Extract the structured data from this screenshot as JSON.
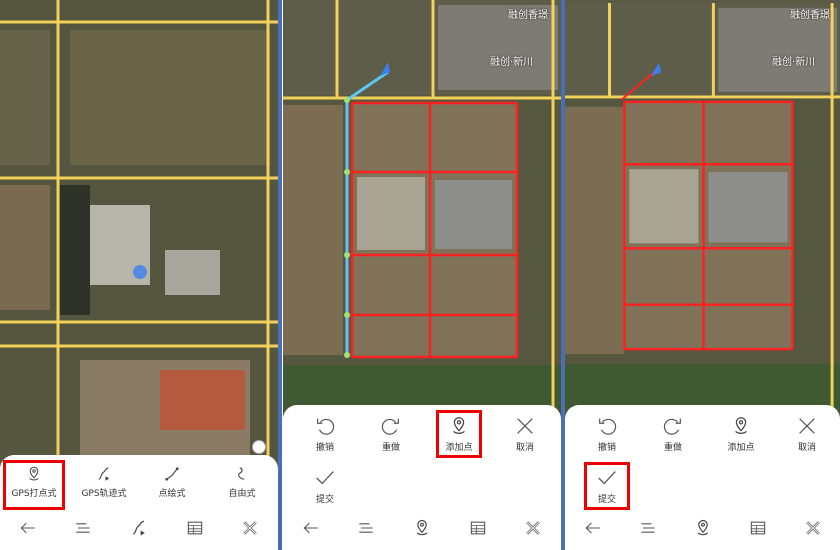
{
  "panels": [
    {
      "mode_tools": [
        {
          "label": "GPS打点式",
          "icon": "gps-pin-icon",
          "selected": true
        },
        {
          "label": "GPS轨迹式",
          "icon": "gps-track-icon"
        },
        {
          "label": "点绘式",
          "icon": "point-draw-icon"
        },
        {
          "label": "自由式",
          "icon": "freehand-icon"
        }
      ]
    },
    {
      "poi": [
        "融创香璟",
        "融创·新川"
      ],
      "edit_tools": [
        {
          "label": "撤销",
          "icon": "undo-icon"
        },
        {
          "label": "重做",
          "icon": "redo-icon"
        },
        {
          "label": "添加点",
          "icon": "add-point-icon",
          "selected": true
        },
        {
          "label": "取消",
          "icon": "close-icon"
        },
        {
          "label": "提交",
          "icon": "check-icon"
        }
      ]
    },
    {
      "poi": [
        "融创香璟",
        "融创·新川"
      ],
      "edit_tools": [
        {
          "label": "撤销",
          "icon": "undo-icon"
        },
        {
          "label": "重做",
          "icon": "redo-icon"
        },
        {
          "label": "添加点",
          "icon": "add-point-icon"
        },
        {
          "label": "取消",
          "icon": "close-icon"
        },
        {
          "label": "提交",
          "icon": "check-icon",
          "selected": true
        }
      ]
    }
  ],
  "nav_icons": [
    "back-arrow-icon",
    "menu-icon",
    "track-icon",
    "table-icon",
    "tools-icon"
  ],
  "colors": {
    "highlight": "#e00000",
    "polygon": "#ff2020",
    "track_line": "#5ac8f0",
    "road": "#f2d25a",
    "location_marker": "#3a7ff0"
  }
}
